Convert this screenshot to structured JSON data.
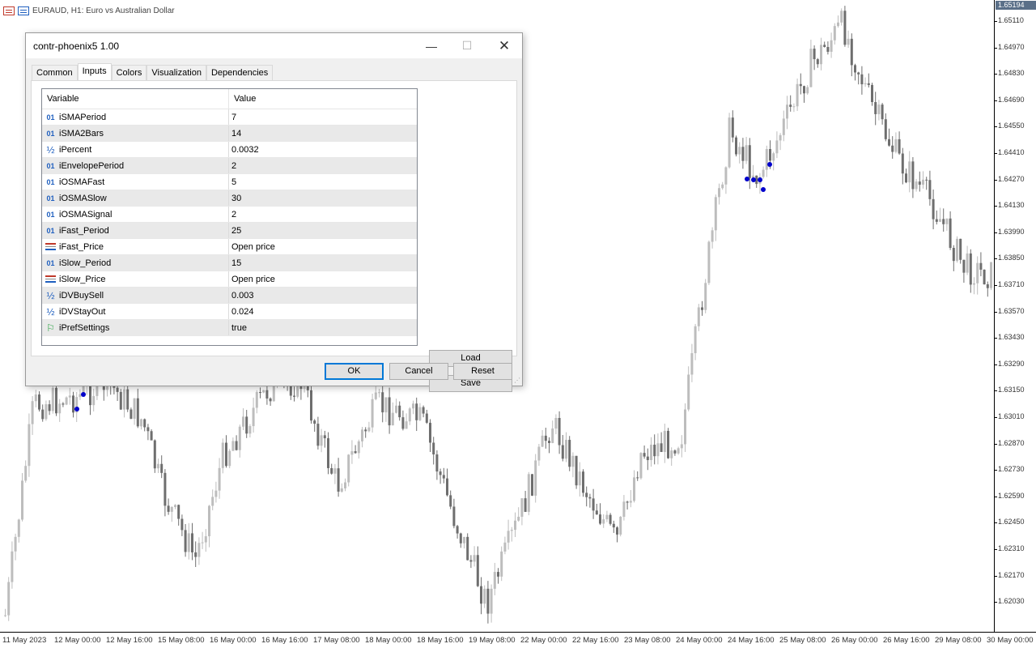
{
  "chart": {
    "title": "EURAUD, H1:  Euro vs Australian Dollar",
    "current_price": "1.65194",
    "price_labels": [
      "1.65110",
      "1.64970",
      "1.64830",
      "1.64690",
      "1.64550",
      "1.64410",
      "1.64270",
      "1.64130",
      "1.63990",
      "1.63850",
      "1.63710",
      "1.63570",
      "1.63430",
      "1.63290",
      "1.63150",
      "1.63010",
      "1.62870",
      "1.62730",
      "1.62590",
      "1.62450",
      "1.62310",
      "1.62170",
      "1.62030"
    ],
    "time_labels": [
      "11 May 2023",
      "12 May 00:00",
      "12 May 16:00",
      "15 May 08:00",
      "16 May 00:00",
      "16 May 16:00",
      "17 May 08:00",
      "18 May 00:00",
      "18 May 16:00",
      "19 May 08:00",
      "22 May 00:00",
      "22 May 16:00",
      "23 May 08:00",
      "24 May 00:00",
      "24 May 16:00",
      "25 May 08:00",
      "26 May 00:00",
      "26 May 16:00",
      "29 May 08:00",
      "30 May 00:00"
    ],
    "colors": {
      "bull": "#bdbdbd",
      "bear": "#6e6e6e",
      "signal": "#0000cc"
    }
  },
  "dialog": {
    "title": "contr-phoenix5 1.00",
    "tabs": [
      "Common",
      "Inputs",
      "Colors",
      "Visualization",
      "Dependencies"
    ],
    "active_tab": "Inputs",
    "table": {
      "col_variable": "Variable",
      "col_value": "Value",
      "rows": [
        {
          "type": "int",
          "name": "iSMAPeriod",
          "value": "7"
        },
        {
          "type": "int",
          "name": "iSMA2Bars",
          "value": "14"
        },
        {
          "type": "double",
          "name": "iPercent",
          "value": "0.0032"
        },
        {
          "type": "int",
          "name": "iEnvelopePeriod",
          "value": "2"
        },
        {
          "type": "int",
          "name": "iOSMAFast",
          "value": "5"
        },
        {
          "type": "int",
          "name": "iOSMASlow",
          "value": "30"
        },
        {
          "type": "int",
          "name": "iOSMASignal",
          "value": "2"
        },
        {
          "type": "int",
          "name": "iFast_Period",
          "value": "25"
        },
        {
          "type": "enum",
          "name": "iFast_Price",
          "value": "Open price"
        },
        {
          "type": "int",
          "name": "iSlow_Period",
          "value": "15"
        },
        {
          "type": "enum",
          "name": "iSlow_Price",
          "value": "Open price"
        },
        {
          "type": "double",
          "name": "iDVBuySell",
          "value": "0.003"
        },
        {
          "type": "double",
          "name": "iDVStayOut",
          "value": "0.024"
        },
        {
          "type": "bool",
          "name": "iPrefSettings",
          "value": "true"
        }
      ]
    },
    "type_glyphs": {
      "int": "01",
      "double": "½",
      "enum": "",
      "bool": "⚐"
    },
    "buttons": {
      "load": "Load",
      "save": "Save",
      "ok": "OK",
      "cancel": "Cancel",
      "reset": "Reset"
    },
    "window_controls": {
      "minimize": "—",
      "maximize": "☐",
      "close": "✕"
    }
  }
}
